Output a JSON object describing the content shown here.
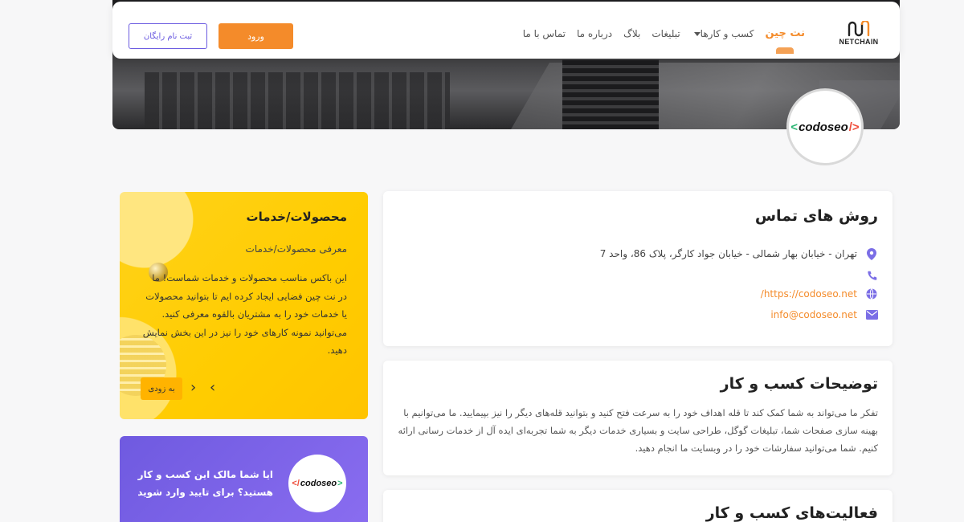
{
  "navbar": {
    "logo_text": "NETCHAIN",
    "items": [
      {
        "label": "نت چین",
        "active": true
      },
      {
        "label": "کسب و کارها",
        "dropdown": true
      },
      {
        "label": "تبلیغات"
      },
      {
        "label": "بلاگ"
      },
      {
        "label": "درباره ما"
      },
      {
        "label": "تماس با ما"
      }
    ],
    "login_label": "ورود",
    "register_label": "ثبت نام رایگان"
  },
  "business": {
    "logo": {
      "prefix": "<",
      "name": "codoseo",
      "suffix": "/>"
    }
  },
  "contact": {
    "title": "روش های تماس",
    "address": "تهران - خیابان بهار شمالی - خیابان جواد کارگر، پلاک 86، واحد 7",
    "phone": "",
    "website": "https://codoseo.net/",
    "email": "info@codoseo.net"
  },
  "description": {
    "title": "توضیحات کسب و کار",
    "text": "تفکر ما می‌تواند به شما کمک کند تا قله اهداف خود را به سرعت فتح کنید و بتوانید قله‌های دیگر را نیز بپیمایید. ما می‌توانیم با بهینه سازی صفحات شما، تبلیغات گوگل، طراحی سایت و بسیاری خدمات دیگر به شما تجربه‌ای ایده آل از خدمات رسانی ارائه کنیم. شما می‌توانید سفارشات خود را در وبسایت ما انجام دهید."
  },
  "activities": {
    "title": "فعالیت‌های کسب و کار"
  },
  "products": {
    "title": "محصولات/خدمات",
    "subtitle": "معرفی محصولات/خدمات",
    "body": "این باکس مناسب محصولات و خدمات شماست! ما در نت چین فضایی ایجاد کرده ایم تا بتوانید محصولات یا خدمات خود را به مشتریان بالقوه معرفی کنید. می‌توانید نمونه کارهای خود را نیز در این بخش نمایش دهید.",
    "soon_label": "به زودی",
    "prev": "‹",
    "next": "›"
  },
  "claim": {
    "text": "ایا شما مالک این کسب و کار هستید؟ برای تایید وارد شوید"
  },
  "colors": {
    "accent": "#f48b2a",
    "purple": "#6f5ae0",
    "yellow": "#ffcc00"
  }
}
